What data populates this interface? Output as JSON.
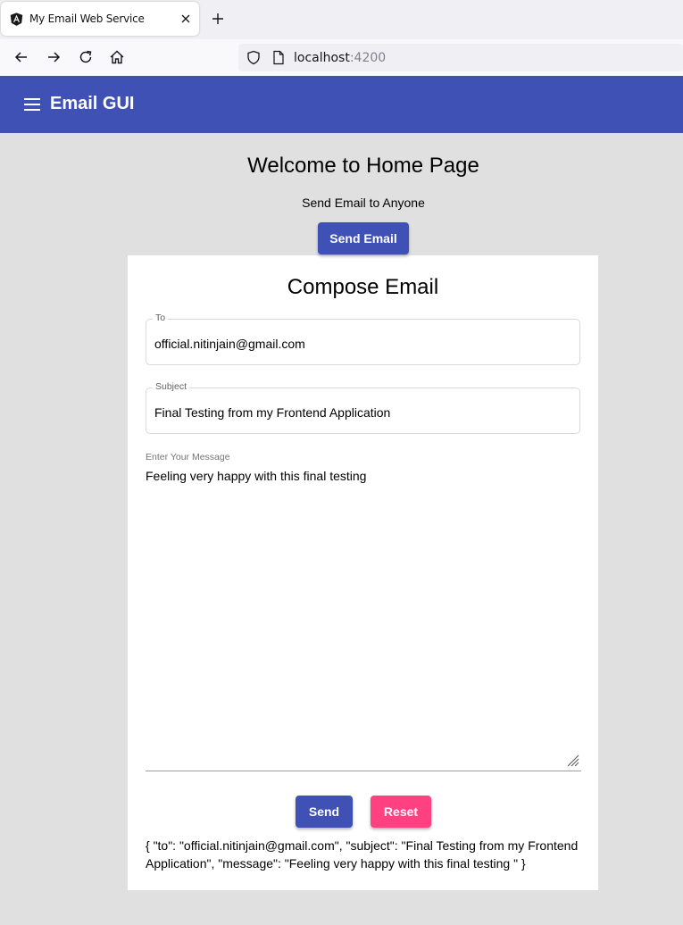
{
  "browser": {
    "tab_title": "My Email Web Service",
    "url_host": "localhost",
    "url_port": ":4200"
  },
  "toolbar": {
    "title": "Email GUI"
  },
  "home": {
    "welcome": "Welcome to Home Page",
    "subtitle": "Send Email to Anyone",
    "send_email_label": "Send Email"
  },
  "compose": {
    "title": "Compose Email",
    "to_label": "To",
    "to_value": "official.nitinjain@gmail.com",
    "subject_label": "Subject",
    "subject_value": "Final Testing from my Frontend Application",
    "message_label": "Enter Your Message",
    "message_value": "Feeling very happy with this final testing",
    "send_label": "Send",
    "reset_label": "Reset",
    "json_preview": "{ \"to\": \"official.nitinjain@gmail.com\", \"subject\": \"Final Testing from my Frontend Application\", \"message\": \"Feeling very happy with this final testing \" }"
  },
  "colors": {
    "primary": "#3f51b5",
    "accent": "#ff4081",
    "background": "#e0e0e0"
  },
  "icons": [
    "angular-icon",
    "close-icon",
    "plus-icon",
    "back-arrow-icon",
    "forward-arrow-icon",
    "reload-icon",
    "home-icon",
    "shield-icon",
    "page-icon",
    "menu-icon",
    "resize-grip-icon"
  ]
}
